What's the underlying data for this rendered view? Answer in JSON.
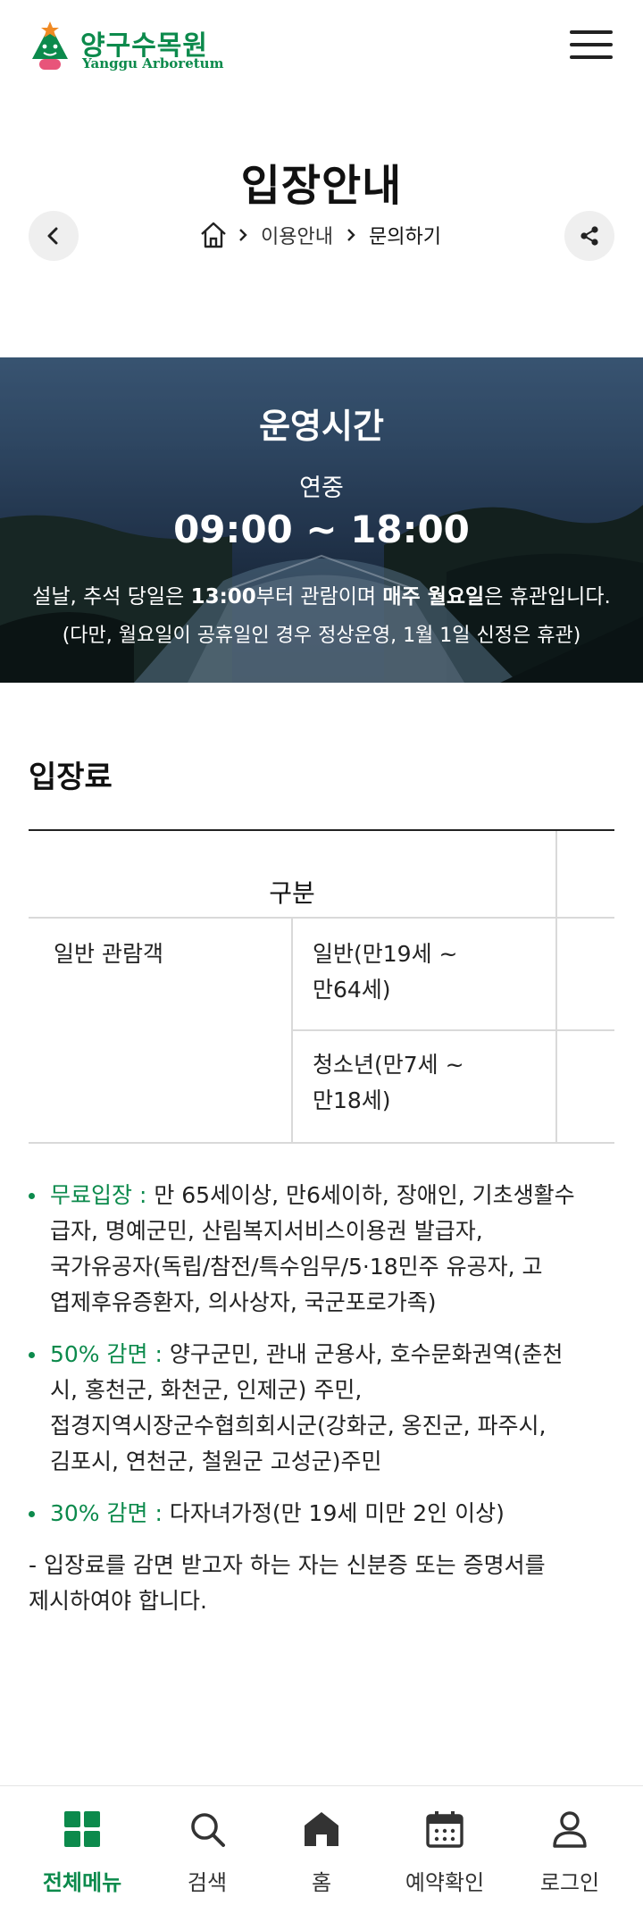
{
  "header": {
    "logo_ko": "양구수목원",
    "logo_en": "Yanggu Arboretum"
  },
  "page": {
    "title": "입장안내",
    "breadcrumb": [
      "이용안내",
      "문의하기"
    ]
  },
  "banner": {
    "title": "운영시간",
    "subtitle": "연중",
    "time": "09:00 ~ 18:00",
    "note1_a": "설날, 추석 당일은 ",
    "note1_b": "13:00",
    "note1_c": "부터 관람이며 ",
    "note1_d": "매주 월요일",
    "note1_e": "은 휴관입니다.",
    "note2": "(다만, 월요일이 공휴일인 경우 정상운영, 1월 1일 신정은 휴관)"
  },
  "admission": {
    "title": "입장료",
    "table": {
      "header": "구분",
      "group": "일반 관람객",
      "rows": [
        {
          "line1": "일반(만19세 ~",
          "line2": "만64세)"
        },
        {
          "line1": "청소년(만7세 ~",
          "line2": "만18세)"
        }
      ]
    },
    "notes": [
      {
        "label": "무료입장 :",
        "lines": [
          " 만 65세이상, 만6세이하, 장애인, 기초생활수",
          "급자, 명예군민, 산림복지서비스이용권 발급자,",
          "국가유공자(독립/참전/특수임무/5·18민주 유공자, 고",
          "엽제후유증환자, 의사상자, 국군포로가족)"
        ]
      },
      {
        "label": "50% 감면 :",
        "lines": [
          " 양구군민, 관내 군용사, 호수문화권역(춘천",
          "시, 홍천군, 화천군, 인제군) 주민,",
          "접경지역시장군수협희회시군(강화군, 옹진군, 파주시,",
          "김포시, 연천군, 철원군 고성군)주민"
        ]
      },
      {
        "label": "30% 감면 :",
        "lines": [
          " 다자녀가정(만 19세 미만 2인 이상)"
        ]
      }
    ],
    "footnote_lines": [
      "- 입장료를 감면 받고자 하는 자는 신분증 또는 증명서를",
      "제시하여야 합니다."
    ]
  },
  "bottom_nav": [
    {
      "label": "전체메뉴",
      "icon": "grid-icon",
      "active": true
    },
    {
      "label": "검색",
      "icon": "search-icon",
      "active": false
    },
    {
      "label": "홈",
      "icon": "home-icon",
      "active": false
    },
    {
      "label": "예약확인",
      "icon": "calendar-icon",
      "active": false
    },
    {
      "label": "로그인",
      "icon": "user-icon",
      "active": false
    }
  ],
  "colors": {
    "brand_green": "#0c8a4c",
    "accent_orange": "#f08a24"
  }
}
